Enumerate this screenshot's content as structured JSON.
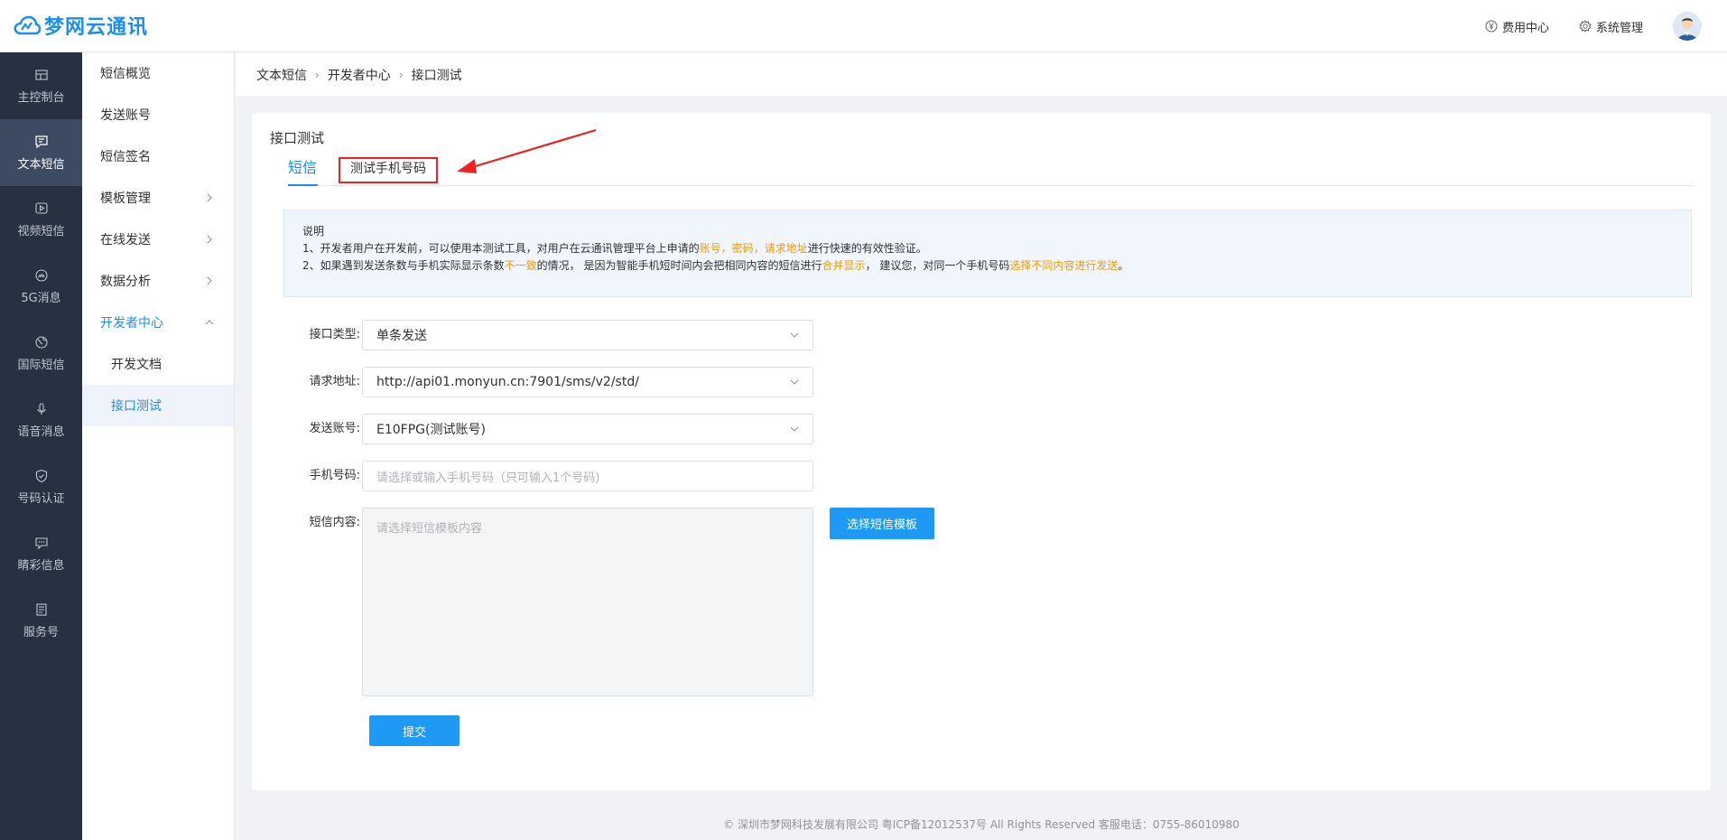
{
  "header": {
    "logo_text": "梦网云通讯",
    "links": [
      {
        "label": "费用中心",
        "icon": "yen-circle-icon"
      },
      {
        "label": "系统管理",
        "icon": "gear-icon"
      }
    ]
  },
  "leftnav": [
    {
      "label": "主控制台",
      "icon": "dashboard-icon"
    },
    {
      "label": "文本短信",
      "icon": "message-icon"
    },
    {
      "label": "视频短信",
      "icon": "video-icon"
    },
    {
      "label": "5G消息",
      "icon": "signal-icon"
    },
    {
      "label": "国际短信",
      "icon": "globe-icon"
    },
    {
      "label": "语音消息",
      "icon": "microphone-icon"
    },
    {
      "label": "号码认证",
      "icon": "shield-icon"
    },
    {
      "label": "睛彩信息",
      "icon": "chat-icon"
    },
    {
      "label": "服务号",
      "icon": "document-icon"
    }
  ],
  "subnav": {
    "items": [
      "短信概览",
      "发送账号",
      "短信签名",
      "模板管理",
      "在线发送",
      "数据分析",
      "开发者中心"
    ],
    "children": [
      "开发文档",
      "接口测试"
    ]
  },
  "breadcrumb": [
    "文本短信",
    "开发者中心",
    "接口测试"
  ],
  "card": {
    "title": "接口测试",
    "tabs": [
      "短信",
      "测试手机号码"
    ],
    "notice": {
      "heading": "说明",
      "line1": {
        "prefix": "1、开发者用户在开发前，可以使用本测试工具，对用户在云通讯管理平台上申请的",
        "hl1": "账号",
        "sep1": "，",
        "hl2": "密码",
        "sep2": "，",
        "hl3": "请求地址",
        "suffix": "进行快速的有效性验证。"
      },
      "line2": {
        "prefix": "2、如果遇到发送条数与手机实际显示条数",
        "hl1": "不一致",
        "mid1": "的情况，  是因为智能手机短时间内会把相同内容的短信进行",
        "hl2": "合并显示",
        "mid2": "，  建议您，对同一个手机号码",
        "hl3": "选择不同内容进行发送",
        "suffix": "。"
      }
    },
    "form": {
      "api_type_label": "接口类型:",
      "api_type_value": "单条发送",
      "url_label": "请求地址:",
      "url_value": "http://api01.monyun.cn:7901/sms/v2/std/",
      "account_label": "发送账号:",
      "account_value": "E10FPG(测试账号)",
      "phone_label": "手机号码:",
      "phone_placeholder": "请选择或输入手机号码（只可输入1个号码)",
      "content_label": "短信内容:",
      "content_placeholder": "请选择短信模板内容",
      "template_button": "选择短信模板",
      "submit_button": "提交"
    }
  },
  "footer": "© 深圳市梦网科技发展有限公司 粤ICP备12012537号 All Rights Reserved 客服电话：0755-86010980",
  "colors": {
    "accent": "#1b8ff0",
    "highlight": "#f29a0e",
    "annotation": "#f02020",
    "sidebar": "#273142"
  }
}
